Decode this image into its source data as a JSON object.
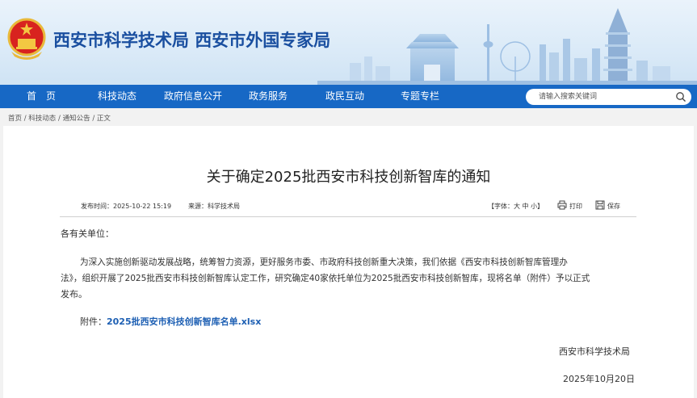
{
  "header": {
    "site_title": "西安市科学技术局  西安市外国专家局"
  },
  "nav": {
    "items": [
      "首　页",
      "科技动态",
      "政府信息公开",
      "政务服务",
      "政民互动",
      "专题专栏"
    ]
  },
  "search": {
    "placeholder": "请输入搜索关键词"
  },
  "breadcrumb": {
    "items": [
      "首页",
      "科技动态",
      "通知公告",
      "正文"
    ],
    "separator": "/"
  },
  "article": {
    "title": "关于确定2025批西安市科技创新智库的通知",
    "publish_time": "发布时间：2025-10-22 15:19",
    "source": "来源：科学技术局",
    "font_size_label": "【字体：大 中 小】",
    "print_label": "打印",
    "save_label": "保存",
    "greeting": "各有关单位：",
    "body_line1": "为深入实施创新驱动发展战略，统筹智力资源，更好服务市委、市政府科技创新重大决策，我们依据《西安市科技创新智库管理办",
    "body_line2": "法》，组织开展了2025批西安市科技创新智库认定工作，研究确定40家依托单位为2025批西安市科技创新智库，现将名单（附件）予以正式",
    "body_line3": "发布。",
    "attachment_label": "附件：",
    "attachment_link": "2025批西安市科技创新智库名单.xlsx",
    "signature": "西安市科学技术局",
    "date": "2025年10月20日"
  },
  "colors": {
    "nav_bg": "#1768c5",
    "title_blue": "#1a4fa0",
    "link_blue": "#1d5fb3"
  }
}
